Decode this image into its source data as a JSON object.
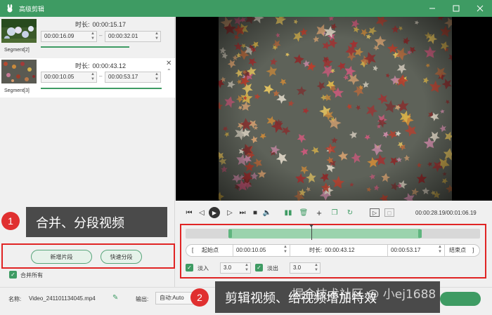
{
  "app": {
    "title": "高级剪辑",
    "icon": "rabbit-logo-icon",
    "accent": "#3e9b63"
  },
  "segments": [
    {
      "label": "Segment[2]",
      "duration_label": "时长:",
      "duration": "00:00:15.17",
      "start": "00:00:16.09",
      "end": "00:00:32.01",
      "progress": 0.73
    },
    {
      "label": "Segment[3]",
      "duration_label": "时长:",
      "duration": "00:00:43.12",
      "start": "00:00:10.05",
      "end": "00:00:53.17",
      "progress": 1.0
    }
  ],
  "left_buttons": {
    "new_segment": "新增片段",
    "quick_split": "快速分段",
    "merge_all": "合并所有",
    "merge_all_checked": true
  },
  "player": {
    "current_time": "00:00:28.19",
    "total_time": "00:01:06.19",
    "time_display": "00:00:28.19/00:01:06.19"
  },
  "range": {
    "start_label": "起始点",
    "start_value": "00:00:10.05",
    "duration_label": "时长:",
    "duration_value": "00:00:43.12",
    "end_value": "00:00:53.17",
    "end_label": "结束点",
    "left_bracket": "[",
    "right_bracket": "]"
  },
  "fade": {
    "fade_in_label": "淡入",
    "fade_in_value": "3.0",
    "fade_in_checked": true,
    "fade_out_label": "淡出",
    "fade_out_value": "3.0",
    "fade_out_checked": true
  },
  "bottom": {
    "name_label": "名称:",
    "name_value": "Video_241101134045.mp4",
    "output_label": "输出:",
    "output_value": "自动:Auto"
  },
  "annotations": {
    "callout1_number": "1",
    "callout1_text": "合并、分段视频",
    "callout2_number": "2",
    "callout2_text": "剪辑视频、给视频增加特效",
    "red": "#e02424"
  },
  "watermark": "掘金技术社区 @ 小ej1688"
}
